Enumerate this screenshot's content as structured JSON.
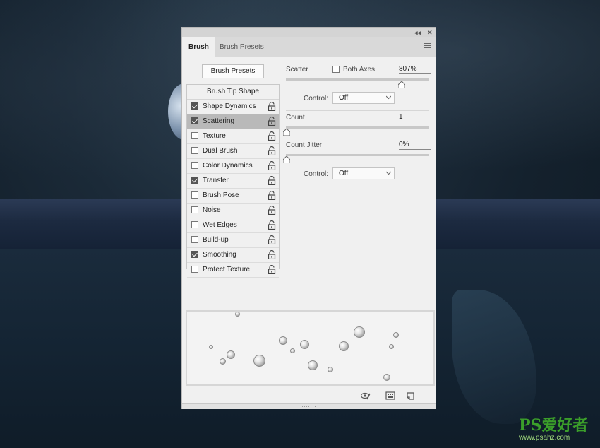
{
  "tabs": [
    {
      "label": "Brush",
      "active": true
    },
    {
      "label": "Brush Presets",
      "active": false
    }
  ],
  "presets_button_label": "Brush Presets",
  "brush_tip_shape_label": "Brush Tip Shape",
  "settings": [
    {
      "label": "Shape Dynamics",
      "checked": true
    },
    {
      "label": "Scattering",
      "checked": true,
      "selected": true
    },
    {
      "label": "Texture",
      "checked": false
    },
    {
      "label": "Dual Brush",
      "checked": false
    },
    {
      "label": "Color Dynamics",
      "checked": false
    },
    {
      "label": "Transfer",
      "checked": true
    },
    {
      "label": "Brush Pose",
      "checked": false
    },
    {
      "label": "Noise",
      "checked": false
    },
    {
      "label": "Wet Edges",
      "checked": false
    },
    {
      "label": "Build-up",
      "checked": false
    },
    {
      "label": "Smoothing",
      "checked": true
    },
    {
      "label": "Protect Texture",
      "checked": false
    }
  ],
  "scattering": {
    "scatter_label": "Scatter",
    "both_axes_label": "Both Axes",
    "both_axes_checked": false,
    "scatter_value": "807%",
    "control_label": "Control:",
    "control_value": "Off",
    "count_label": "Count",
    "count_value": "1",
    "count_jitter_label": "Count Jitter",
    "count_jitter_value": "0%",
    "control2_label": "Control:",
    "control2_value": "Off"
  },
  "icons": {
    "title_collapse": "collapse-icon",
    "title_close": "close-icon",
    "panel_menu": "panel-menu-icon",
    "lock": "lock-icon",
    "footer": [
      "toggle-preview-icon",
      "brush-settings-grid-icon",
      "new-brush-icon"
    ]
  },
  "watermark": {
    "main": "PS爱好者",
    "sub": "www.psahz.com"
  },
  "colors": {
    "panel": "#f0f0f0",
    "selected_row": "#b9b9b9",
    "watermark": "#3b9e2a"
  }
}
